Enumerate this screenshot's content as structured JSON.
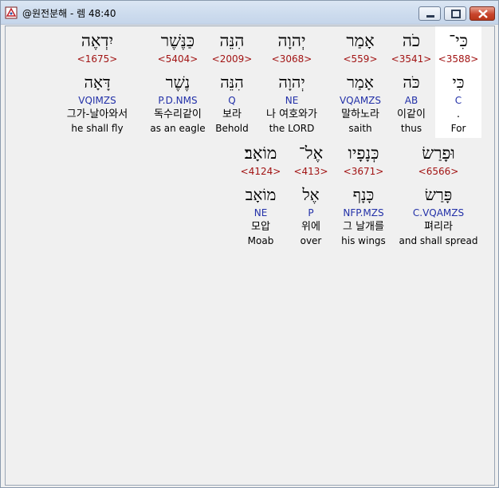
{
  "window": {
    "title": "@원전분해 - 렘 48:40"
  },
  "colors": {
    "strong": "#a21414",
    "morph": "#2230a8",
    "highlight_bg": "#ffffff"
  },
  "rows": [
    {
      "words": [
        {
          "hebrew": "כִּי־",
          "strong": "<3588>",
          "lemma": "כִּי",
          "morph": "C",
          "korean": ".",
          "english": "For"
        },
        {
          "hebrew": "כֹה",
          "strong": "<3541>",
          "lemma": "כֹּה",
          "morph": "AB",
          "korean": "이같이",
          "english": "thus"
        },
        {
          "hebrew": "אָמַר",
          "strong": "<559>",
          "lemma": "אָמַר",
          "morph": "VQAMZS",
          "korean": "말하노라",
          "english": "saith"
        },
        {
          "hebrew": "יְהוָה",
          "strong": "<3068>",
          "lemma": "יְהוָה",
          "morph": "NE",
          "korean": "나 여호와가",
          "english": "the LORD"
        },
        {
          "hebrew": "הִנֵּה",
          "strong": "<2009>",
          "lemma": "הִנֵּה",
          "morph": "Q",
          "korean": "보라",
          "english": "Behold"
        },
        {
          "hebrew": "כַּנֶּשֶׁר",
          "strong": "<5404>",
          "lemma": "נֶשֶׁר",
          "morph": "P.D.NMS",
          "korean": "독수리같이",
          "english": "as an eagle"
        },
        {
          "hebrew": "יִדְאֶה",
          "strong": "<1675>",
          "lemma": "דָּאָה",
          "morph": "VQIMZS",
          "korean": "그가-날아와서",
          "english": "he shall fly"
        }
      ]
    },
    {
      "words": [
        {
          "hebrew": "וּפָרַשׂ",
          "strong": "<6566>",
          "lemma": "פָּרַשׂ",
          "morph": "C.VQAMZS",
          "korean": "펴리라",
          "english": "and shall spread"
        },
        {
          "hebrew": "כְּנָפָיו",
          "strong": "<3671>",
          "lemma": "כָּנָף",
          "morph": "NFP.MZS",
          "korean": "그 날개를",
          "english": "his wings"
        },
        {
          "hebrew": "אֶל־",
          "strong": "<413>",
          "lemma": "אֶל",
          "morph": "P",
          "korean": "위에",
          "english": "over"
        },
        {
          "hebrew": "מוֹאָב׃",
          "strong": "<4124>",
          "lemma": "מוֹאָב",
          "morph": "NE",
          "korean": "모압",
          "english": "Moab"
        }
      ]
    }
  ]
}
